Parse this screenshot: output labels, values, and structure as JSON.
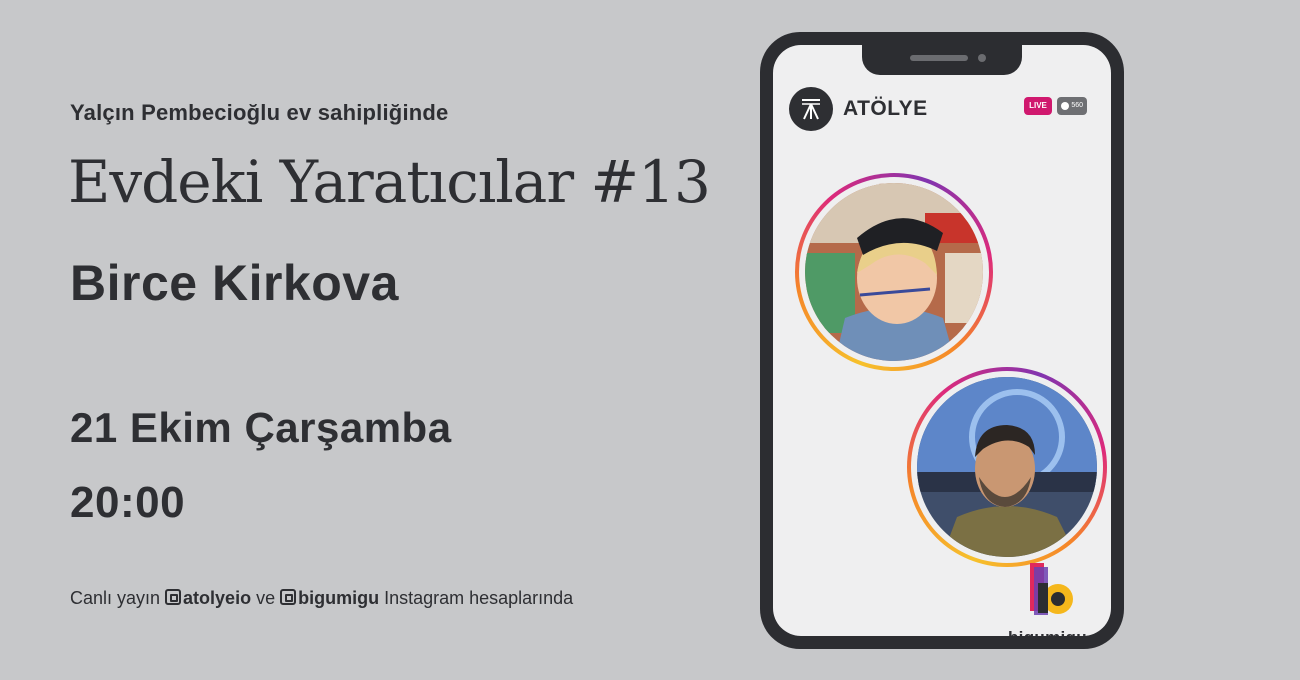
{
  "event": {
    "host_line": "Yalçın Pembecioğlu ev sahipliğinde",
    "title": "Evdeki Yaratıcılar #13",
    "guest": "Birce Kirkova",
    "date": "21 Ekim Çarşamba",
    "time": "20:00"
  },
  "footer": {
    "prefix": "Canlı yayın ",
    "handle1": "atolyeio",
    "middle": " ve ",
    "handle2": "bigumigu",
    "suffix": " Instagram hesaplarında"
  },
  "phone": {
    "brand": "ATÖLYE",
    "live_badge": "LIVE",
    "viewer_count": "560",
    "partner_logo": "bigumigu"
  },
  "colors": {
    "background": "#c7c8ca",
    "text": "#2e2f33",
    "phone_frame": "#2c2d31",
    "live": "#d0186e"
  }
}
